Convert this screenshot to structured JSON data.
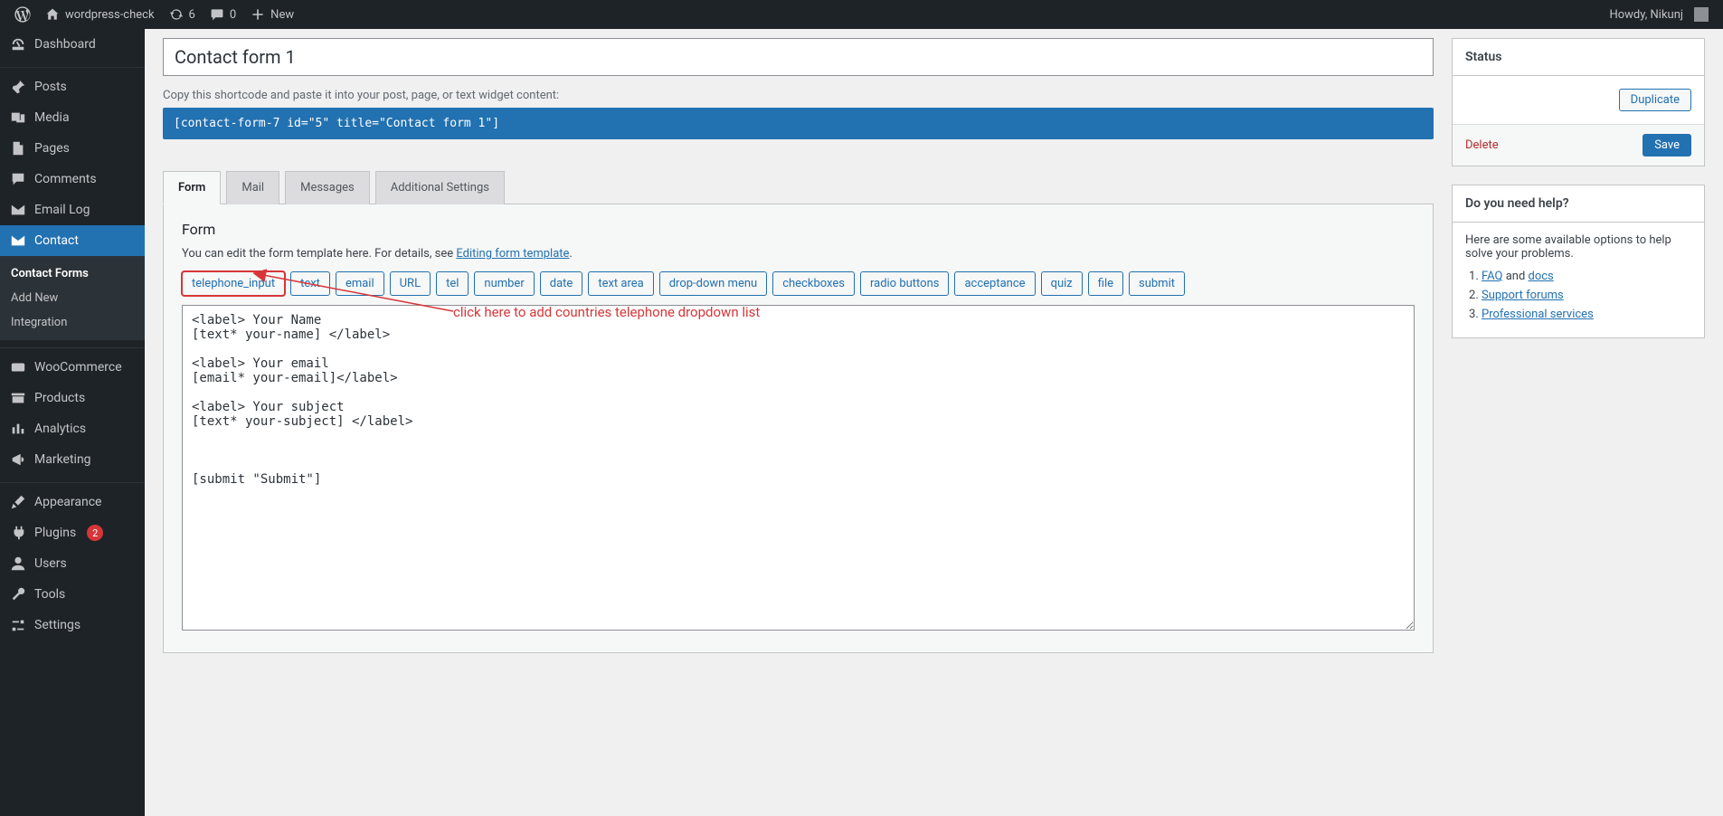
{
  "adminbar": {
    "site_name": "wordpress-check",
    "updates_count": "6",
    "comments_count": "0",
    "new_label": "New",
    "howdy": "Howdy, Nikunj"
  },
  "sidebar": {
    "dashboard": "Dashboard",
    "posts": "Posts",
    "media": "Media",
    "pages": "Pages",
    "comments": "Comments",
    "email_log": "Email Log",
    "contact": "Contact",
    "contact_sub": {
      "forms": "Contact Forms",
      "add_new": "Add New",
      "integration": "Integration"
    },
    "woocommerce": "WooCommerce",
    "products": "Products",
    "analytics": "Analytics",
    "marketing": "Marketing",
    "appearance": "Appearance",
    "plugins": "Plugins",
    "plugins_count": "2",
    "users": "Users",
    "tools": "Tools",
    "settings": "Settings"
  },
  "form": {
    "title": "Contact form 1",
    "shortcode_hint": "Copy this shortcode and paste it into your post, page, or text widget content:",
    "shortcode": "[contact-form-7 id=\"5\" title=\"Contact form 1\"]",
    "tabs": {
      "form": "Form",
      "mail": "Mail",
      "messages": "Messages",
      "additional": "Additional Settings"
    },
    "panel_heading": "Form",
    "panel_desc_pre": "You can edit the form template here. For details, see ",
    "panel_desc_link": "Editing form template",
    "tags": [
      "telephone_input",
      "text",
      "email",
      "URL",
      "tel",
      "number",
      "date",
      "text area",
      "drop-down menu",
      "checkboxes",
      "radio buttons",
      "acceptance",
      "quiz",
      "file",
      "submit"
    ],
    "template": "<label> Your Name\n[text* your-name] </label>\n\n<label> Your email\n[email* your-email]</label>\n\n<label> Your subject\n[text* your-subject] </label>\n\n\n\n[submit \"Submit\"]",
    "annotation": "click here to add countries telephone dropdown list"
  },
  "status": {
    "heading": "Status",
    "duplicate": "Duplicate",
    "delete": "Delete",
    "save": "Save"
  },
  "help": {
    "heading": "Do you need help?",
    "intro": "Here are some available options to help solve your problems.",
    "faq": "FAQ",
    "and": " and ",
    "docs": "docs",
    "support": "Support forums",
    "pro": "Professional services"
  }
}
